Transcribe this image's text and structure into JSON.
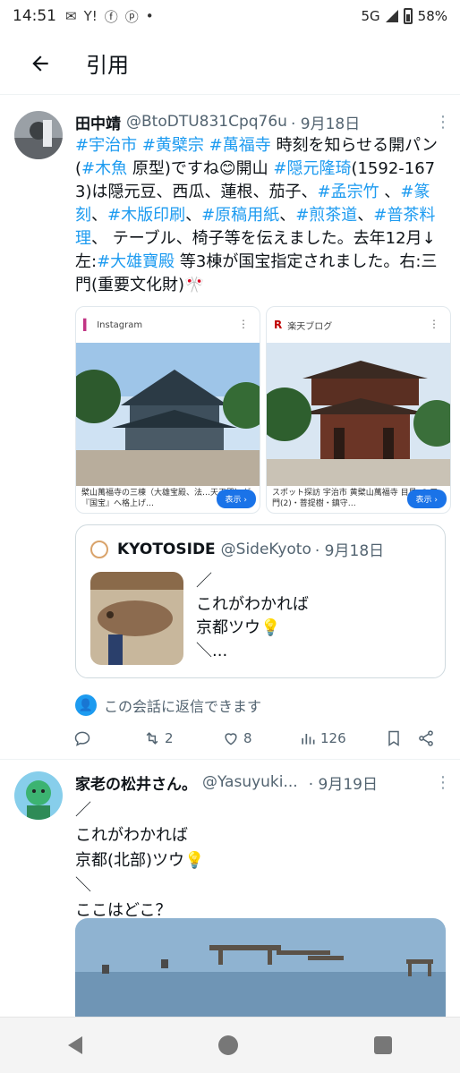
{
  "status_bar": {
    "time": "14:51",
    "network": "5G",
    "battery": "58%"
  },
  "app_bar": {
    "title": "引用"
  },
  "tweet1": {
    "name": "田中靖",
    "handle": "@BtoDTU831Cpq76u",
    "date": "· 9月18日",
    "text_parts": [
      {
        "t": "#宇治市",
        "tag": true
      },
      {
        "t": " ",
        "tag": false
      },
      {
        "t": "#黄檗宗",
        "tag": true
      },
      {
        "t": " ",
        "tag": false
      },
      {
        "t": "#萬福寺",
        "tag": true
      },
      {
        "t": " 時刻を知らせる開パン(",
        "tag": false
      },
      {
        "t": "#木魚",
        "tag": true
      },
      {
        "t": " 原型)ですね😊開山 ",
        "tag": false
      },
      {
        "t": "#隠元隆琦",
        "tag": true
      },
      {
        "t": "(1592-1673)は隠元豆、西瓜、蓮根、茄子、",
        "tag": false
      },
      {
        "t": "#孟宗竹",
        "tag": true
      },
      {
        "t": " 、",
        "tag": false
      },
      {
        "t": "#篆刻",
        "tag": true
      },
      {
        "t": "、",
        "tag": false
      },
      {
        "t": "#木版印刷",
        "tag": true
      },
      {
        "t": "、",
        "tag": false
      },
      {
        "t": "#原稿用紙",
        "tag": true
      },
      {
        "t": "、",
        "tag": false
      },
      {
        "t": "#煎茶道",
        "tag": true
      },
      {
        "t": "、",
        "tag": false
      },
      {
        "t": "#普茶料理",
        "tag": true
      },
      {
        "t": "、 テーブル、椅子等を伝えました。去年12月↓左:",
        "tag": false
      },
      {
        "t": "#大雄寶殿",
        "tag": true
      },
      {
        "t": " 等3棟が国宝指定されました。右:三門(重要文化財)🎌",
        "tag": false
      }
    ],
    "cards": [
      {
        "source": "Instagram",
        "caption": "檗山萬福寺の三棟（大雄宝殿、法…天王殿）が『国宝』へ格上げ…",
        "button": "表示 ›"
      },
      {
        "source": "楽天ブログ",
        "caption": "スポット探訪 宇治市 黄檗山萬福寺 目見 -3 三門(2)・菩提樹・鎮守…",
        "button": "表示 ›"
      }
    ],
    "quote": {
      "name": "KYOTOSIDE",
      "handle": "@SideKyoto",
      "date": "· 9月18日",
      "lines": [
        "／",
        "これがわかれば",
        "京都ツウ💡",
        "＼..."
      ]
    },
    "reply_note": "この会話に返信できます",
    "stats": {
      "retweets": "2",
      "likes": "8",
      "views": "126"
    }
  },
  "tweet2": {
    "name": "家老の松井さん。",
    "handle": "@Yasuyuki...",
    "date": "· 9月19日",
    "lines": [
      "／",
      "これがわかれば",
      "京都(北部)ツウ💡",
      "＼",
      "ここはどこ？"
    ]
  }
}
